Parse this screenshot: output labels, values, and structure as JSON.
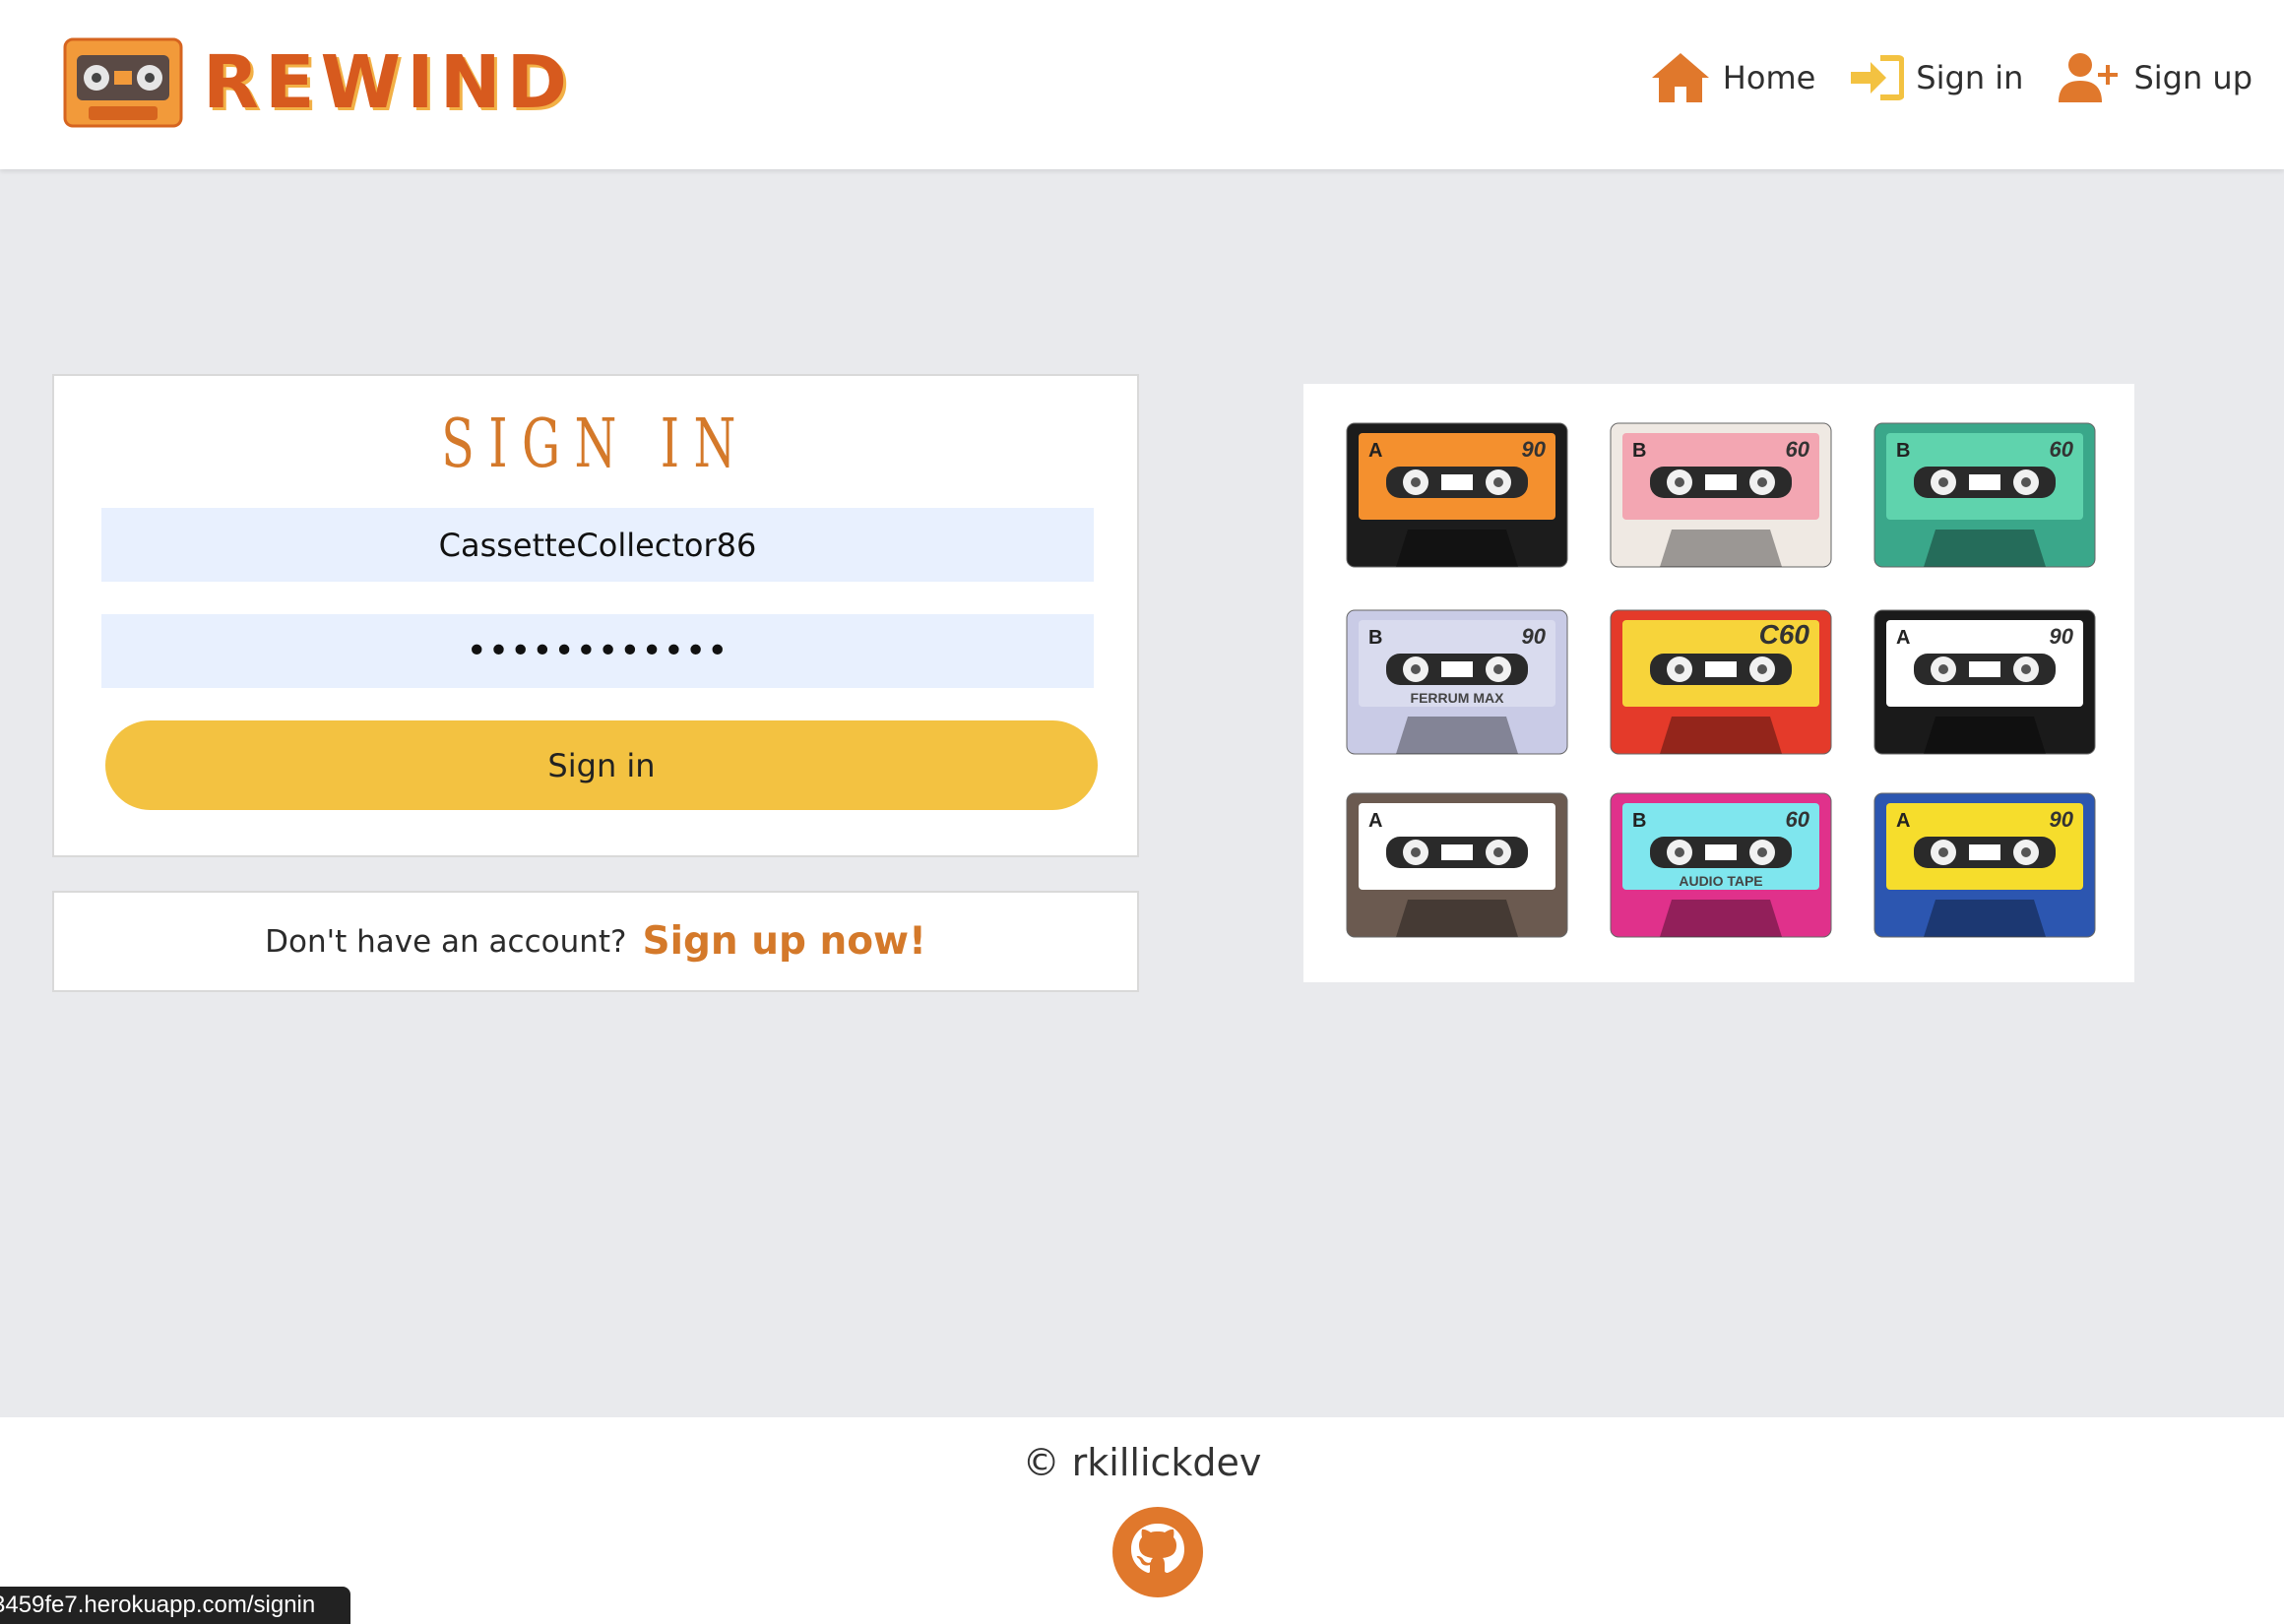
{
  "brand": {
    "name": "REWIND"
  },
  "nav": {
    "items": [
      {
        "label": "Home",
        "icon": "home-icon"
      },
      {
        "label": "Sign in",
        "icon": "sign-in-icon"
      },
      {
        "label": "Sign up",
        "icon": "user-plus-icon"
      }
    ]
  },
  "signin": {
    "title": "SIGN IN",
    "username_value": "CassetteCollector86",
    "password_value": "••••••••••••",
    "button_label": "Sign in"
  },
  "signup": {
    "question": "Don't have an account?",
    "link_label": "Sign up now!"
  },
  "cassettes": [
    {
      "side": "A",
      "number": "90",
      "color": "#f4902e",
      "body": "#1c1c1c"
    },
    {
      "side": "B",
      "number": "60",
      "color": "#f3a6b2",
      "body": "#efe9e3"
    },
    {
      "side": "B",
      "number": "60",
      "color": "#5fd3ad",
      "body": "#3aa78a"
    },
    {
      "side": "B",
      "number": "90",
      "color": "#d9dbee",
      "body": "#c9cbe6",
      "label": "FERRUM MAX"
    },
    {
      "side": "",
      "number": "C60",
      "color": "#f7d43a",
      "body": "#e43a2a"
    },
    {
      "side": "A",
      "number": "90",
      "color": "#ffffff",
      "body": "#1a1a1a"
    },
    {
      "side": "A",
      "number": "",
      "color": "#ffffff",
      "body": "#6b5a50"
    },
    {
      "side": "B",
      "number": "60",
      "color": "#7fe6ee",
      "body": "#e0318b",
      "label": "AUDIO TAPE"
    },
    {
      "side": "A",
      "number": "90",
      "color": "#f6dd2c",
      "body": "#2c56b0"
    }
  ],
  "footer": {
    "copyright": "© rkillickdev"
  },
  "status_bar": {
    "url": "3459fe7.herokuapp.com/signin"
  },
  "colors": {
    "accent": "#d4792a",
    "button": "#f3c241",
    "field_bg": "#e8f0fe"
  }
}
